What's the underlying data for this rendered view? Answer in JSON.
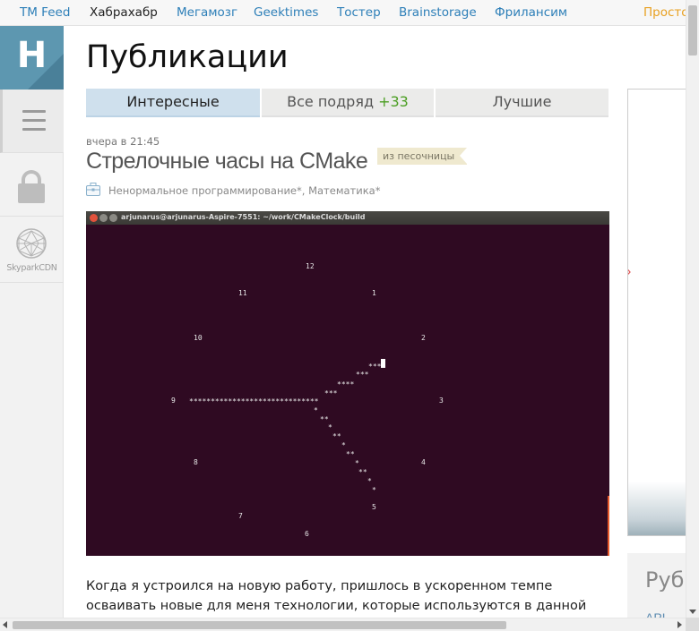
{
  "topnav": {
    "items": [
      {
        "label": "TM Feed"
      },
      {
        "label": "Хабрахабр",
        "active": true
      },
      {
        "label": "Мегамозг"
      },
      {
        "label": "Geektimes"
      },
      {
        "label": "Тостер"
      },
      {
        "label": "Brainstorage"
      },
      {
        "label": "Фрилансим"
      }
    ],
    "promo": "Просто"
  },
  "sidebar": {
    "logo_letter": "H",
    "menu_icon": "hamburger-icon",
    "lock_icon": "lock-icon",
    "cdn_label": "SkyparkCDN"
  },
  "main": {
    "page_title": "Публикации",
    "tabs": [
      {
        "label": "Интересные",
        "active": true
      },
      {
        "label": "Все подряд",
        "count": "+33"
      },
      {
        "label": "Лучшие"
      }
    ],
    "post": {
      "time": "вчера в 21:45",
      "title": "Стрелочные часы на CMake",
      "badge": "из песочницы",
      "hubs": "Ненормальное программирование*, Математика*",
      "terminal": {
        "title": "arjunarus@arjunarus-Aspire-7551: ~/work/CMakeClock/build",
        "clock_numbers": [
          "12",
          "1",
          "2",
          "3",
          "4",
          "5",
          "6",
          "7",
          "8",
          "9",
          "10",
          "11"
        ],
        "hour_hand_text": "******************************",
        "minute_hand_segments": [
          "***",
          "***",
          "****",
          "***",
          "*",
          "**",
          "*",
          "**",
          "*",
          "**",
          "*",
          "**",
          "*",
          "*"
        ],
        "hour_hand_segments": [
          "*",
          "**",
          "*",
          "**",
          "*",
          "**",
          "*",
          "**",
          "*",
          "*"
        ]
      },
      "excerpt": "Когда я устроился на новую работу, пришлось в ускоренном темпе осваивать новые для меня технологии, которые используются в данной компании. Одной"
    }
  },
  "right": {
    "rubric_heading": "Рубр",
    "rubric_link": "API"
  },
  "colors": {
    "link": "#2d7fb8",
    "logo_bg": "#5d97b0",
    "terminal_bg": "#2f0a22",
    "active_tab": "#cfe0ed",
    "count_green": "#4b9e23"
  }
}
